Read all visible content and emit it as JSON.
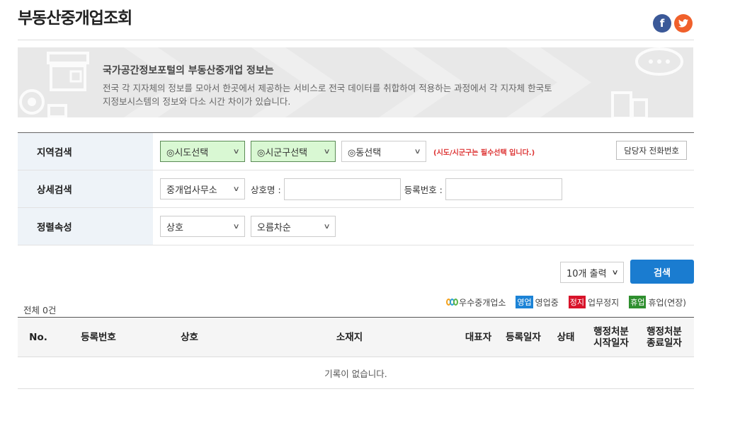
{
  "page": {
    "title": "부동산중개업조회"
  },
  "social": {
    "facebook": "f",
    "twitter": "t"
  },
  "banner": {
    "title": "국가공간정보포털의 부동산중개업 정보는",
    "desc_line1": "전국 각 지자체의 정보를 모아서 한곳에서 제공하는 서비스로 전국 데이터를 취합하여 적용하는 과정에서 각 지자체 한국토",
    "desc_line2": "지정보시스템의 정보와 다소 시간 차이가 있습니다."
  },
  "search": {
    "region_label": "지역검색",
    "sido": "◎시도선택",
    "sigungu": "◎시군구선택",
    "dong": "◎동선택",
    "required_note": "(시도/시군구는 필수선택 입니다.)",
    "phone_button": "담당자 전화번호",
    "detail_label": "상세검색",
    "office_type": "중개업사무소",
    "company_label": "상호명 :",
    "company_value": "",
    "reg_label": "등록번호 :",
    "reg_value": "",
    "sort_label": "정렬속성",
    "sort_field": "상호",
    "sort_order": "오름차순"
  },
  "controls": {
    "count": "10개 출력",
    "search_button": "검색"
  },
  "summary": {
    "total": "전체 0건"
  },
  "legend": {
    "excellent": "우수중개업소",
    "open_badge": "영업",
    "open_label": "영업중",
    "stop_badge": "정지",
    "stop_label": "업무정지",
    "rest_badge": "휴업",
    "rest_label": "휴업(연장)"
  },
  "table": {
    "columns": [
      "No.",
      "등록번호",
      "상호",
      "소재지",
      "대표자",
      "등록일자",
      "상태",
      "행정처분 시작일자",
      "행정처분 종료일자"
    ],
    "col_start_1": "행정처분",
    "col_start_2": "시작일자",
    "col_end_1": "행정처분",
    "col_end_2": "종료일자",
    "empty_message": "기록이 없습니다."
  }
}
